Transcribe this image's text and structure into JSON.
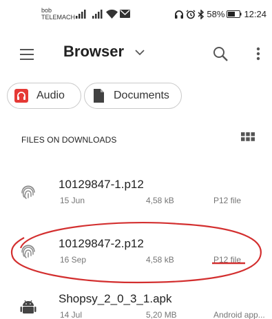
{
  "status_bar": {
    "carrier_top": "bob",
    "carrier_bottom": "TELEMACH",
    "battery": "58%",
    "time": "12:24"
  },
  "app_bar": {
    "title": "Browser"
  },
  "chips": [
    {
      "label": "Audio",
      "icon": "headphones-icon",
      "color": "#e53935"
    },
    {
      "label": "Documents",
      "icon": "document-icon",
      "color": "#424242"
    }
  ],
  "section": {
    "title": "FILES ON DOWNLOADS"
  },
  "files": [
    {
      "name": "10129847-1.p12",
      "date": "15 Jun",
      "size": "4,58 kB",
      "type": "P12 file",
      "icon": "fingerprint-icon"
    },
    {
      "name": "10129847-2.p12",
      "date": "16 Sep",
      "size": "4,58 kB",
      "type": "P12 file",
      "icon": "fingerprint-icon"
    },
    {
      "name": "Shopsy_2_0_3_1.apk",
      "date": "14 Jul",
      "size": "5,20 MB",
      "type": "Android app...",
      "icon": "android-icon"
    }
  ],
  "annotation": {
    "color": "#d32f2f"
  }
}
